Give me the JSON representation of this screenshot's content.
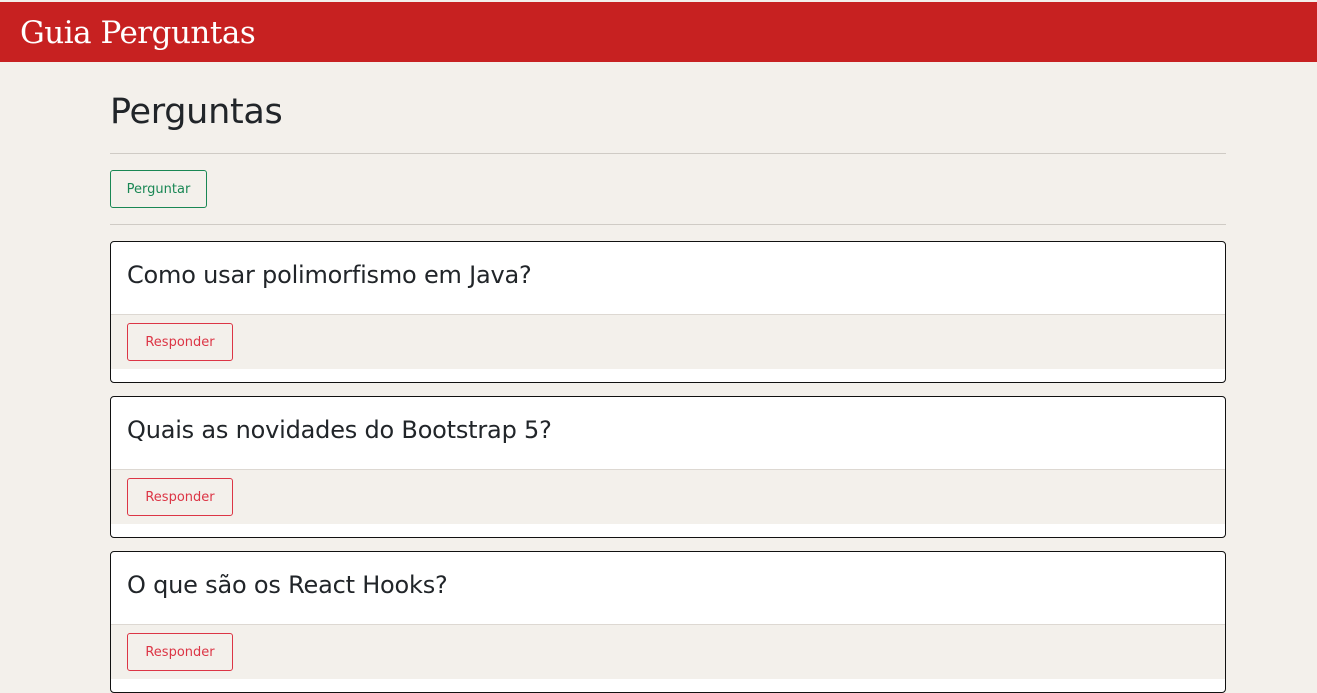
{
  "header": {
    "brand": "Guia Perguntas",
    "color": "#c72121"
  },
  "main": {
    "title": "Perguntas",
    "ask_button": "Perguntar",
    "questions": [
      {
        "title": "Como usar polimorfismo em Java?",
        "action": "Responder"
      },
      {
        "title": "Quais as novidades do Bootstrap 5?",
        "action": "Responder"
      },
      {
        "title": "O que são os React Hooks?",
        "action": "Responder"
      }
    ]
  }
}
